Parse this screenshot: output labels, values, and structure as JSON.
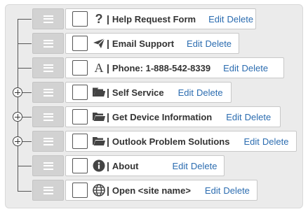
{
  "items": [
    {
      "label": "Help Request Form",
      "icon": "question-icon",
      "separator": "|",
      "edit": "Edit",
      "delete": "Delete",
      "has_children": false
    },
    {
      "label": "Email Support",
      "icon": "paper-plane-icon",
      "separator": "|",
      "edit": "Edit",
      "delete": "Delete",
      "has_children": false
    },
    {
      "label": "Phone: 1-888-542-8339",
      "icon": "font-letter-icon",
      "separator": "|",
      "edit": "Edit",
      "delete": "Delete",
      "has_children": false
    },
    {
      "label": "Self Service",
      "icon": "folder-icon",
      "separator": "|",
      "edit": "Edit",
      "delete": "Delete",
      "has_children": true
    },
    {
      "label": "Get Device Information",
      "icon": "folder-icon",
      "separator": "|",
      "edit": "Edit",
      "delete": "Delete",
      "has_children": true
    },
    {
      "label": "Outlook Problem Solutions",
      "icon": "folder-icon",
      "separator": "|",
      "edit": "Edit",
      "delete": "Delete",
      "has_children": true
    },
    {
      "label": "About",
      "icon": "info-circle-icon",
      "separator": "|",
      "edit": "Edit",
      "delete": "Delete",
      "has_children": false
    },
    {
      "label": "Open <site name>",
      "icon": "globe-icon",
      "separator": "|",
      "edit": "Edit",
      "delete": "Delete",
      "has_children": false
    }
  ],
  "glyphs": {
    "question": "?",
    "letter_a": "A"
  },
  "colors": {
    "link": "#2b6cb0",
    "handle": "#d2d2d2",
    "background": "#ebebeb",
    "text": "#333333"
  }
}
